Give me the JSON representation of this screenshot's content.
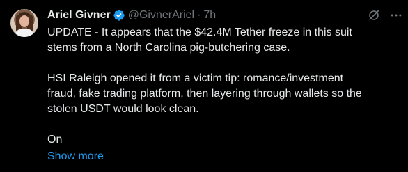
{
  "author": {
    "name": "Ariel Givner",
    "handle": "@GivnerAriel",
    "separator": "·",
    "timestamp": "7h",
    "verified": true,
    "verified_color": "#1d9bf0"
  },
  "tweet": {
    "paragraph1": [
      "UPDATE - It appears that the $42.4M Tether freeze in this suit",
      "stems from a North Carolina pig-butchering case."
    ],
    "paragraph2": [
      "HSI Raleigh opened it from a victim tip: romance/investment",
      "fraud, fake trading platform, then layering through wallets so the",
      "stolen USDT would look clean."
    ],
    "paragraph3": [
      "On"
    ],
    "show_more_label": "Show more"
  },
  "icons": {
    "grok": "grok-icon",
    "more": "more-options-icon",
    "verified": "verified-badge-icon"
  },
  "colors": {
    "background": "#000000",
    "text": "#e7e9ea",
    "muted": "#71767b",
    "link": "#1d9bf0"
  }
}
